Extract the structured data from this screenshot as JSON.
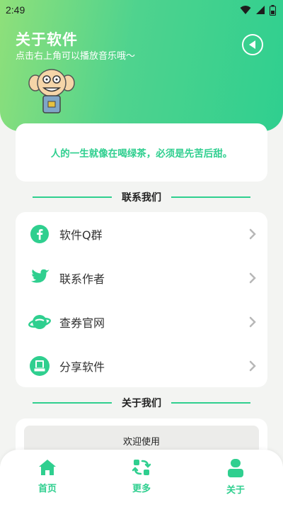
{
  "status_bar": {
    "time": "2:49"
  },
  "header": {
    "title": "关于软件",
    "subtitle": "点击右上角可以播放音乐哦～",
    "accent_color": "#2fcf8f",
    "play_icon": "play-music-icon"
  },
  "quote": {
    "text": "人的一生就像在喝绿茶，必须是先苦后甜。"
  },
  "contact_section": {
    "title": "联系我们",
    "items": [
      {
        "label": "软件Q群",
        "icon": "facebook-icon"
      },
      {
        "label": "联系作者",
        "icon": "twitter-bird-icon"
      },
      {
        "label": "查券官网",
        "icon": "planet-icon"
      },
      {
        "label": "分享软件",
        "icon": "share-app-icon"
      }
    ]
  },
  "about_section": {
    "title": "关于我们",
    "welcome_text": "欢迎使用"
  },
  "tabbar": {
    "tabs": [
      {
        "label": "首页",
        "icon": "home-icon"
      },
      {
        "label": "更多",
        "icon": "more-icon"
      },
      {
        "label": "关于",
        "icon": "user-icon"
      }
    ]
  }
}
